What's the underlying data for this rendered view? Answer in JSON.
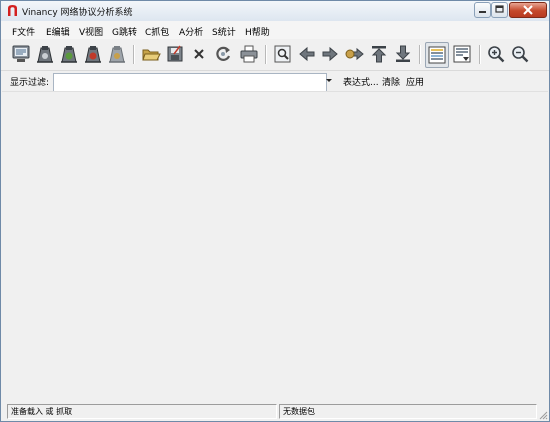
{
  "window": {
    "title": "Vinancy 网络协议分析系统"
  },
  "window_controls": {
    "minimize": "0",
    "maximize": "1",
    "close": "r"
  },
  "menu": [
    {
      "label": "F文件"
    },
    {
      "label": "E编辑"
    },
    {
      "label": "V视图"
    },
    {
      "label": "G跳转"
    },
    {
      "label": "C抓包"
    },
    {
      "label": "A分析"
    },
    {
      "label": "S统计"
    },
    {
      "label": "H帮助"
    }
  ],
  "toolbar": {
    "icons": [
      "interface-list-icon",
      "capture-options-icon",
      "start-capture-icon",
      "stop-capture-icon",
      "restart-capture-icon",
      "open-file-icon",
      "save-file-icon",
      "close-file-icon",
      "reload-icon",
      "print-icon",
      "find-packet-icon",
      "go-back-icon",
      "go-forward-icon",
      "go-to-packet-icon",
      "go-first-icon",
      "go-last-icon",
      "colorize-icon",
      "auto-scroll-icon",
      "zoom-in-icon",
      "zoom-out-icon"
    ]
  },
  "filter": {
    "label": "显示过滤:",
    "value": "",
    "expression_label": "表达式...",
    "clear_label": "清除",
    "apply_label": "应用"
  },
  "status": {
    "left": "准备载入 或 抓取",
    "right": "无数据包"
  },
  "colors": {
    "window_border": "#6f8aa8",
    "close_button": "#c5492c",
    "app_icon": "#d32020"
  }
}
